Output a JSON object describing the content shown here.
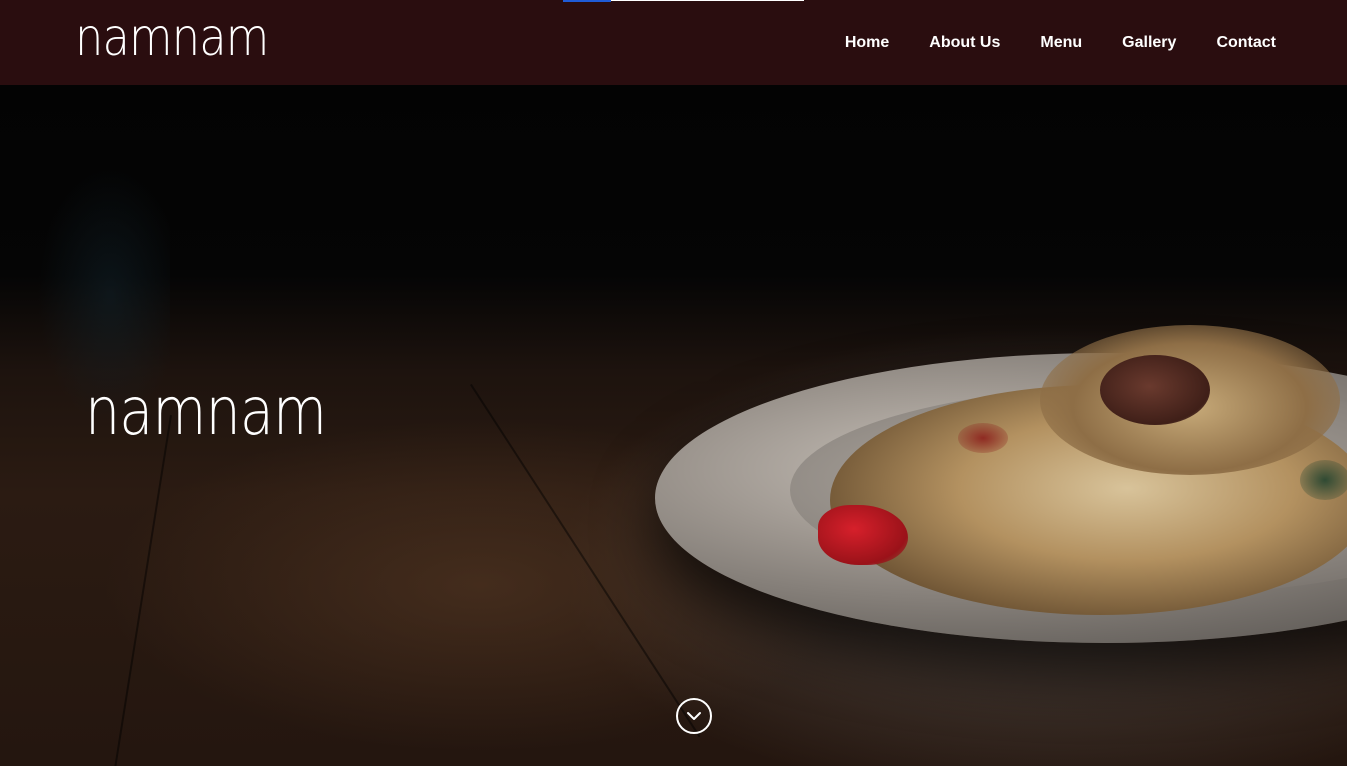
{
  "header": {
    "logo_text": "namnam",
    "nav": {
      "home": "Home",
      "about": "About Us",
      "menu": "Menu",
      "gallery": "Gallery",
      "contact": "Contact"
    },
    "background_color": "#2a0d0f"
  },
  "hero": {
    "title": "namnam",
    "scroll_icon": "chevron-down-circle-icon"
  }
}
